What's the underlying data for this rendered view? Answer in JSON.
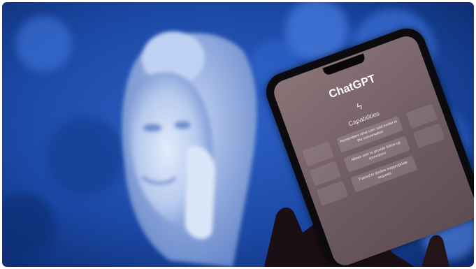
{
  "phone": {
    "app_title": "ChatGPT",
    "capabilities_icon": "sparkle-icon",
    "capabilities_heading": "Capabilities",
    "capabilities": [
      "Remembers what user said earlier in the conversation",
      "Allows user to provide follow-up corrections",
      "Trained to decline inappropriate requests"
    ]
  },
  "colors": {
    "background_blue": "#1e4fb0",
    "statue_light": "#c9d8f5",
    "screen": "#76626a"
  }
}
